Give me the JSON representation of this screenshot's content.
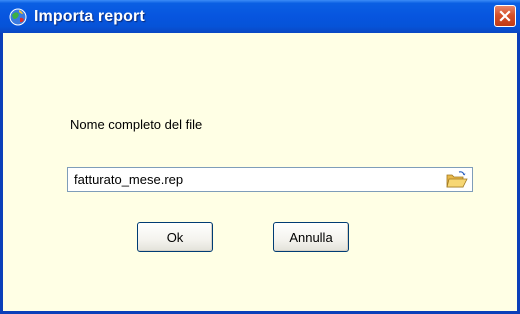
{
  "window": {
    "title": "Importa report",
    "app_icon": "app-globe-icon",
    "close_icon": "close-icon"
  },
  "form": {
    "label": "Nome completo del file",
    "file_value": "fatturato_mese.rep",
    "browse_icon": "open-folder-icon"
  },
  "buttons": {
    "ok_label": "Ok",
    "cancel_label": "Annulla"
  },
  "colors": {
    "title_bar": "#0755df",
    "window_bg": "#ffffe5",
    "close_button": "#d6512a",
    "border": "#0a3fb9"
  }
}
